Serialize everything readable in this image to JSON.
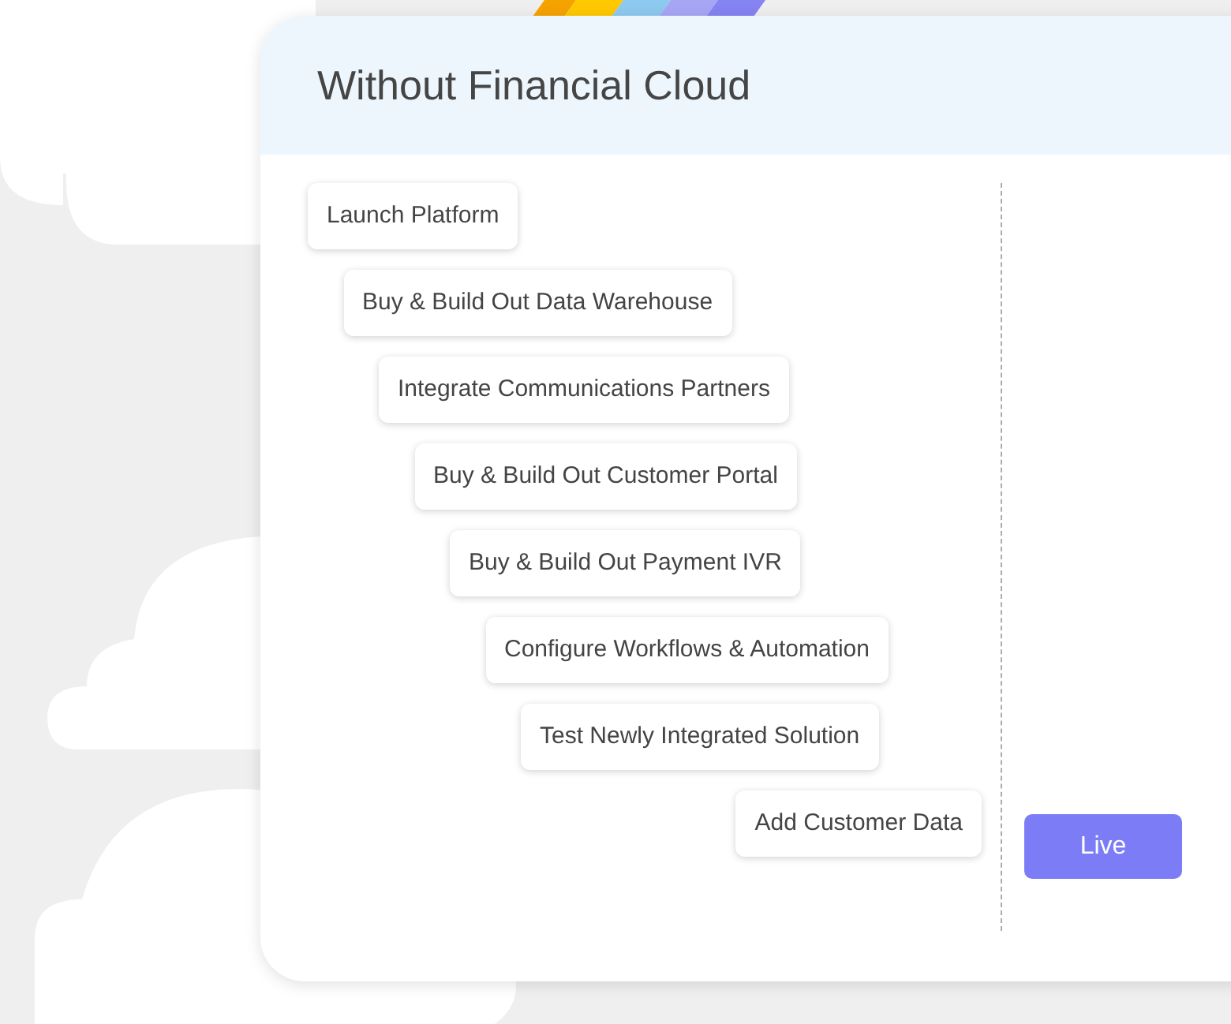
{
  "card": {
    "title": "Without Financial Cloud",
    "steps": [
      "Launch Platform",
      "Buy & Build Out Data Warehouse",
      "Integrate Communications Partners",
      "Buy & Build Out Customer Portal",
      "Buy & Build Out Payment IVR",
      "Configure Workflows & Automation",
      "Test Newly Integrated Solution",
      "Add Customer Data"
    ],
    "live_label": "Live"
  }
}
